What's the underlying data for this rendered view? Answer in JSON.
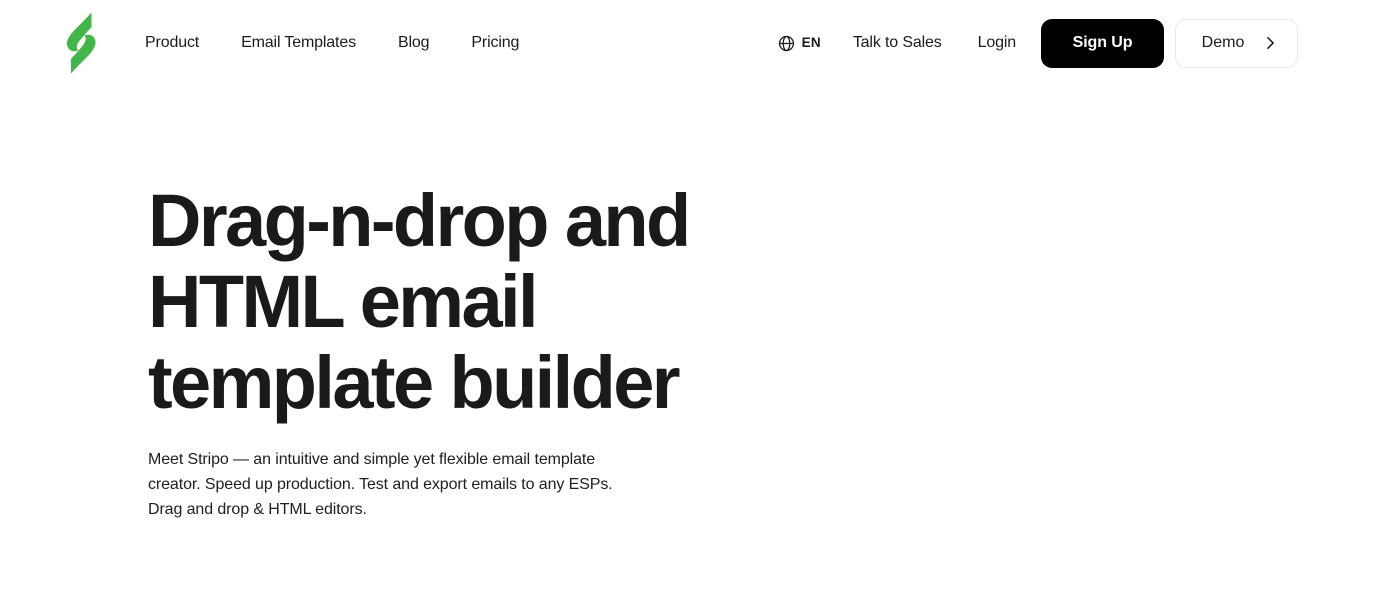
{
  "brand": {
    "logo_name": "stripo-logo",
    "logo_color": "#43b649",
    "logo_color_dark": "#34a23c"
  },
  "header": {
    "nav": [
      {
        "label": "Product"
      },
      {
        "label": "Email Templates"
      },
      {
        "label": "Blog"
      },
      {
        "label": "Pricing"
      }
    ],
    "language": {
      "icon": "globe-icon",
      "label": "EN"
    },
    "talk_to_sales": "Talk to Sales",
    "login": "Login",
    "signup": "Sign Up",
    "demo": "Demo",
    "demo_icon": "chevron-right-icon",
    "signup_bg": "#000000",
    "signup_color": "#ffffff",
    "demo_border": "#e8e8e8"
  },
  "hero": {
    "title": "Drag-n-drop and\nHTML email\ntemplate builder",
    "title_color": "#1a1a1a",
    "subtitle": "Meet Stripo — an intuitive and simple yet flexible email template\ncreator. Speed up production. Test and export emails to any ESPs.\nDrag and drop & HTML editors."
  },
  "page": {
    "background": "#ffffff"
  }
}
